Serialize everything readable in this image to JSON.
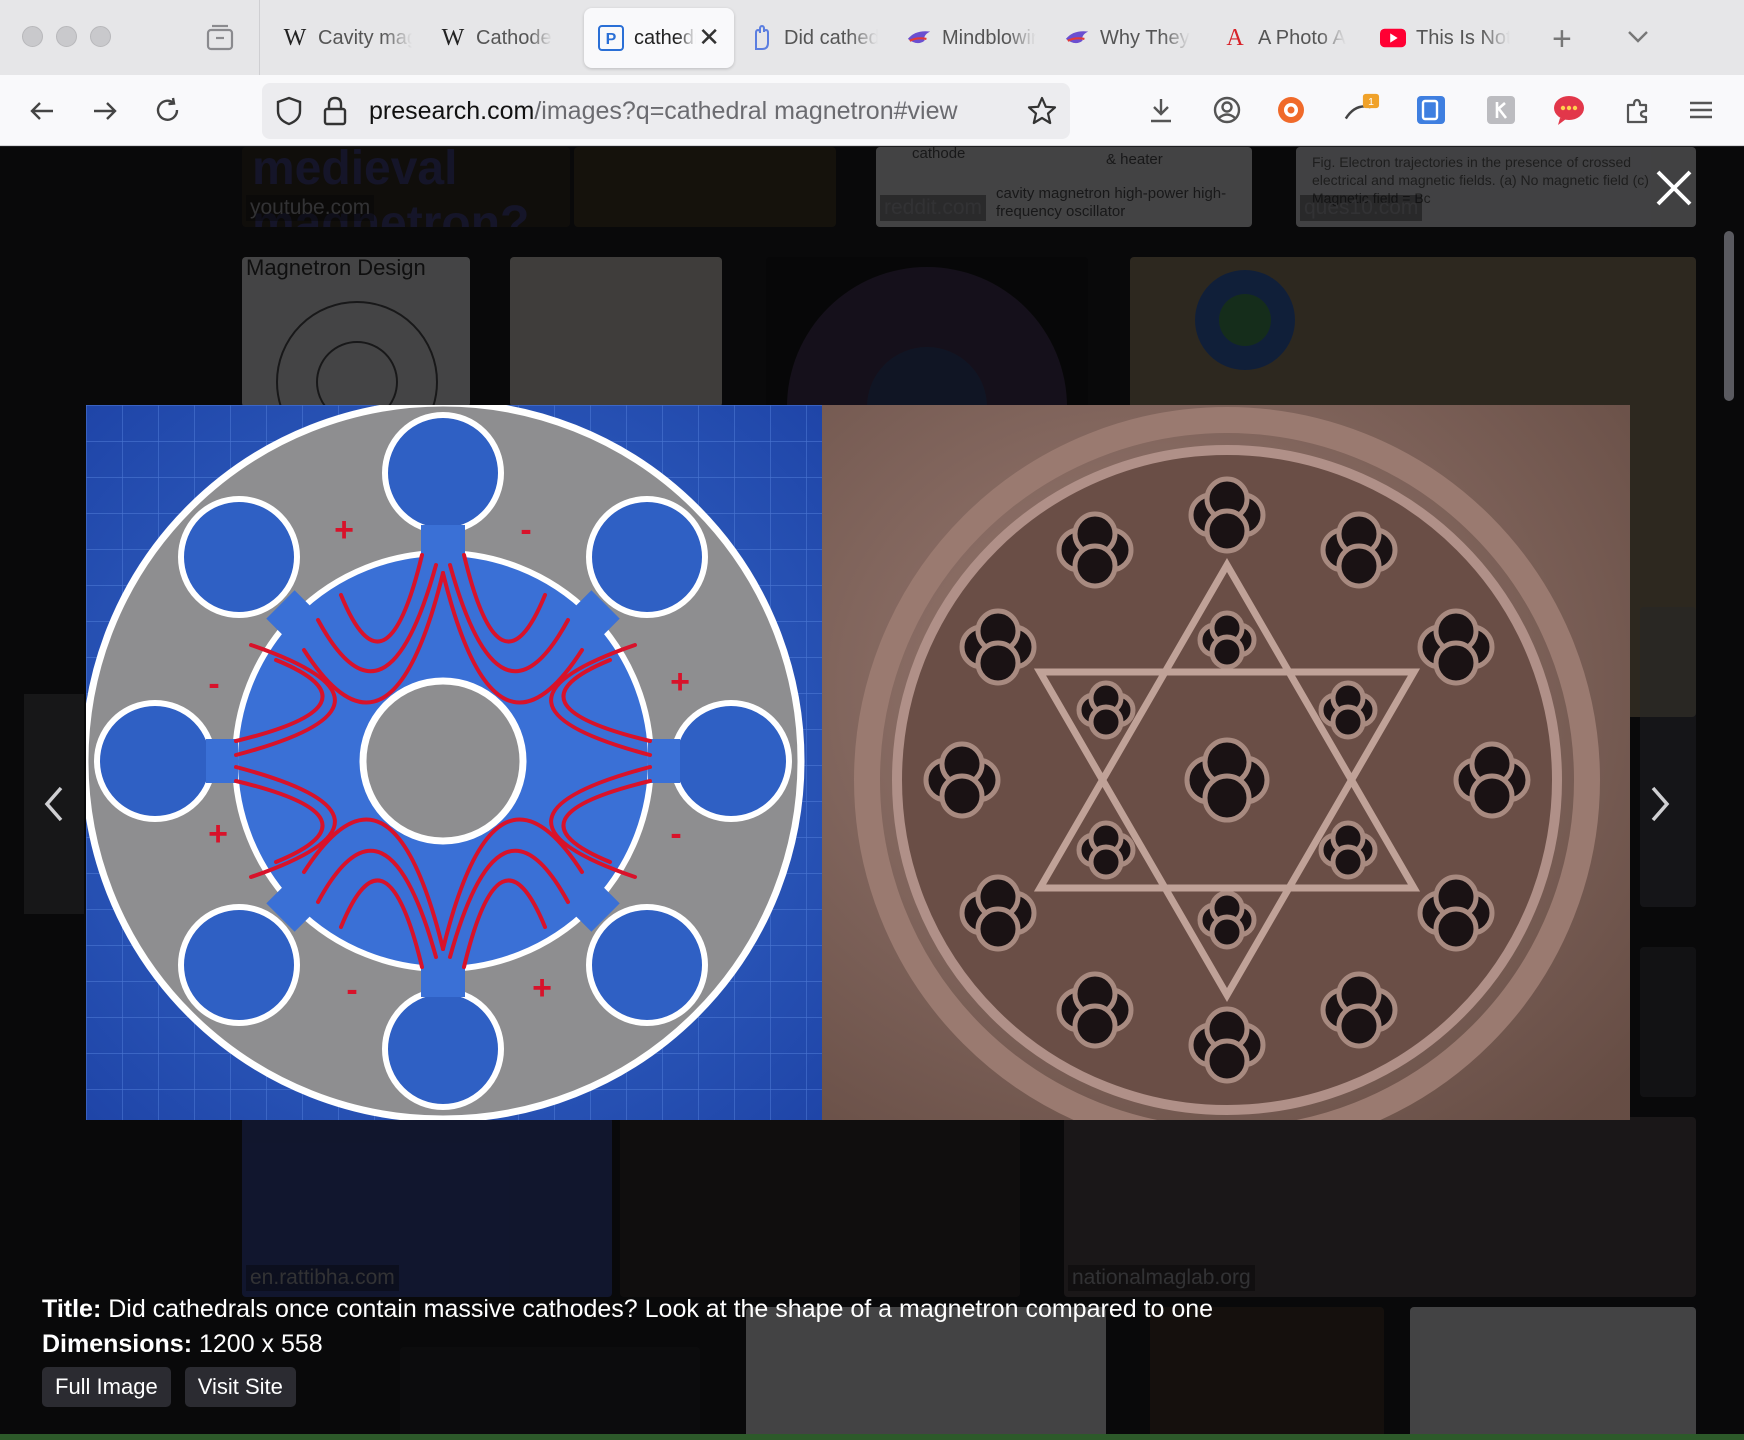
{
  "tabs": [
    {
      "favicon": "W",
      "label": "Cavity magnetron"
    },
    {
      "favicon": "W",
      "label": "Cathode"
    },
    {
      "favicon": "P",
      "label": "cathedral magnetron",
      "active": true
    },
    {
      "favicon": "hand-icon",
      "label": "Did cathedrals"
    },
    {
      "favicon": "bird-icon",
      "label": "Mindblowing"
    },
    {
      "favicon": "bird-icon",
      "label": "Why They"
    },
    {
      "favicon": "A",
      "label": "A Photo A"
    },
    {
      "favicon": "youtube-icon",
      "label": "This Is Not"
    }
  ],
  "address": {
    "host": "presearch.com",
    "path": "/images?q=cathedral magnetron#view"
  },
  "thumbs": {
    "sources": [
      "youtube.com",
      "reddit.com",
      "ques10.com",
      "en.rattibha.com",
      "nationalmaglab.org"
    ],
    "top_text": "medieval magnetron?",
    "magnetron_design_title": "Magnetron Design",
    "reddit_caption": "cavity magnetron high-power high-frequency oscillator",
    "ques10_caption": "Fig. Electron trajectories in the presence of crossed electrical and magnetic fields. (a) No magnetic field (c) Magnetic field = Bc",
    "cathode_label": "cathode",
    "heater_label": "& heater",
    "badge_count": "1"
  },
  "diagram": {
    "plus": "+",
    "minus": "-"
  },
  "lightbox": {
    "title_label": "Title:",
    "title": "Did cathedrals once contain massive cathodes? Look at the shape of a magnetron compared to one",
    "dimensions_label": "Dimensions:",
    "dimensions": "1200 x 558",
    "full_image": "Full Image",
    "visit_site": "Visit Site"
  },
  "colors": {
    "blueprint": "#2f5fbf",
    "field_lines": "#d8122a",
    "stone": "#8a6e64"
  }
}
